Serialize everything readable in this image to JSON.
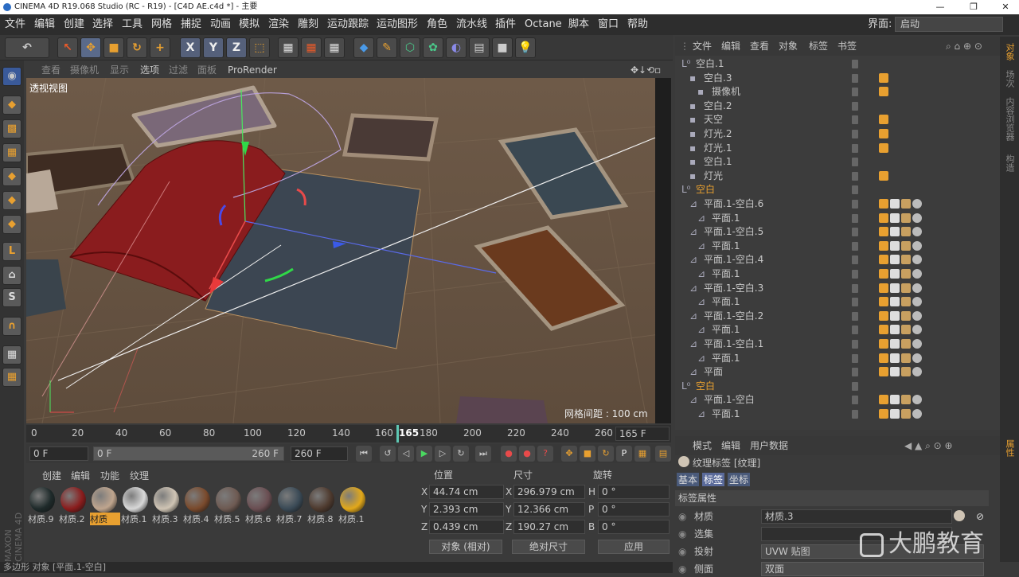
{
  "titlebar": {
    "text": "CINEMA 4D R19.068 Studio (RC - R19) - [C4D AE.c4d *] - 主要",
    "min": "—",
    "max": "❐",
    "close": "✕"
  },
  "menu": [
    "文件",
    "编辑",
    "创建",
    "选择",
    "工具",
    "网格",
    "捕捉",
    "动画",
    "模拟",
    "渲染",
    "雕刻",
    "运动跟踪",
    "运动图形",
    "角色",
    "流水线",
    "插件",
    "Octane",
    "脚本",
    "窗口",
    "帮助"
  ],
  "layout": {
    "label": "界面:",
    "value": "启动"
  },
  "toolbar": {
    "undo": "↶",
    "x": "X",
    "y": "Y",
    "z": "Z"
  },
  "viewport": {
    "menu": [
      "查看",
      "摄像机",
      "显示",
      "选项",
      "过滤",
      "面板",
      "ProRender"
    ],
    "label": "透视视图",
    "grid": "网格间距 : 100 cm"
  },
  "timeline": {
    "ticks": [
      "0",
      "20",
      "40",
      "60",
      "80",
      "100",
      "120",
      "140",
      "160",
      "165",
      "180",
      "200",
      "220",
      "240",
      "260"
    ],
    "frame": "165 F"
  },
  "transport": {
    "start": "0 F",
    "range_start": "0 F",
    "range_end": "260 F",
    "end": "260 F"
  },
  "materials": {
    "tabs": [
      "创建",
      "编辑",
      "功能",
      "纹理"
    ],
    "items": [
      {
        "name": "材质.9",
        "color": "#1e2a2a"
      },
      {
        "name": "材质.2",
        "color": "#8a1c1c"
      },
      {
        "name": "材质",
        "color": "#bfa58e"
      },
      {
        "name": "材质.1",
        "color": "#d8d8d8"
      },
      {
        "name": "材质.3",
        "color": "#cfc4b4"
      },
      {
        "name": "材质.4",
        "color": "#7a4a2c"
      },
      {
        "name": "材质.5",
        "color": "#6e5a52"
      },
      {
        "name": "材质.6",
        "color": "#6a4e52"
      },
      {
        "name": "材质.7",
        "color": "#3a4a56"
      },
      {
        "name": "材质.8",
        "color": "#4e3a2e"
      },
      {
        "name": "材质.1",
        "color": "#e2a81a"
      }
    ]
  },
  "coords": {
    "heads": [
      "位置",
      "尺寸",
      "旋转"
    ],
    "rows": [
      {
        "a": "X",
        "pos": "44.74 cm",
        "b": "X",
        "size": "296.979 cm",
        "c": "H",
        "rot": "0 °"
      },
      {
        "a": "Y",
        "pos": "2.393 cm",
        "b": "Y",
        "size": "12.366 cm",
        "c": "P",
        "rot": "0 °"
      },
      {
        "a": "Z",
        "pos": "0.439 cm",
        "b": "Z",
        "size": "190.27 cm",
        "c": "B",
        "rot": "0 °"
      }
    ],
    "mode": "对象 (相对)",
    "sizemode": "绝对尺寸",
    "apply": "应用"
  },
  "status": "多边形 对象 [平面.1-空白]",
  "objmenu": [
    "文件",
    "编辑",
    "查看",
    "对象",
    "标签",
    "书签"
  ],
  "objects": [
    {
      "name": "空白.1",
      "ind": 0,
      "col": "#c8c8c8"
    },
    {
      "name": "空白.3",
      "ind": 1,
      "col": "#c8c8c8"
    },
    {
      "name": "摄像机",
      "ind": 2,
      "col": "#c8c8c8"
    },
    {
      "name": "空白.2",
      "ind": 1,
      "col": "#c8c8c8"
    },
    {
      "name": "天空",
      "ind": 1,
      "col": "#c8c8c8"
    },
    {
      "name": "灯光.2",
      "ind": 1,
      "col": "#c8c8c8"
    },
    {
      "name": "灯光.1",
      "ind": 1,
      "col": "#c8c8c8"
    },
    {
      "name": "空白.1",
      "ind": 1,
      "col": "#c8c8c8"
    },
    {
      "name": "灯光",
      "ind": 1,
      "col": "#c8c8c8"
    },
    {
      "name": "空白",
      "ind": 0,
      "col": "#e8a030"
    },
    {
      "name": "平面.1-空白.6",
      "ind": 1,
      "col": "#c8c8c8"
    },
    {
      "name": "平面.1",
      "ind": 2,
      "col": "#c8c8c8"
    },
    {
      "name": "平面.1-空白.5",
      "ind": 1,
      "col": "#c8c8c8"
    },
    {
      "name": "平面.1",
      "ind": 2,
      "col": "#c8c8c8"
    },
    {
      "name": "平面.1-空白.4",
      "ind": 1,
      "col": "#c8c8c8"
    },
    {
      "name": "平面.1",
      "ind": 2,
      "col": "#c8c8c8"
    },
    {
      "name": "平面.1-空白.3",
      "ind": 1,
      "col": "#c8c8c8"
    },
    {
      "name": "平面.1",
      "ind": 2,
      "col": "#c8c8c8"
    },
    {
      "name": "平面.1-空白.2",
      "ind": 1,
      "col": "#c8c8c8"
    },
    {
      "name": "平面.1",
      "ind": 2,
      "col": "#c8c8c8"
    },
    {
      "name": "平面.1-空白.1",
      "ind": 1,
      "col": "#c8c8c8"
    },
    {
      "name": "平面.1",
      "ind": 2,
      "col": "#c8c8c8"
    },
    {
      "name": "平面",
      "ind": 1,
      "col": "#c8c8c8"
    },
    {
      "name": "空白",
      "ind": 0,
      "col": "#e8a030"
    },
    {
      "name": "平面.1-空白",
      "ind": 1,
      "col": "#c8c8c8"
    },
    {
      "name": "平面.1",
      "ind": 2,
      "col": "#c8c8c8"
    }
  ],
  "sidetabs": [
    "对象",
    "场次",
    "内容浏览器",
    "构造"
  ],
  "attr": {
    "menu": [
      "模式",
      "编辑",
      "用户数据"
    ],
    "title": "纹理标签 [纹理]",
    "tabs": [
      "基本",
      "标签",
      "坐标"
    ],
    "section": "标签属性",
    "rows": [
      {
        "label": "材质",
        "value": "材质.3"
      },
      {
        "label": "选集",
        "value": ""
      },
      {
        "label": "投射",
        "value": "UVW 贴图"
      },
      {
        "label": "侧面",
        "value": "双面"
      }
    ]
  },
  "side_right": "属性",
  "watermark": "大鹏教育"
}
